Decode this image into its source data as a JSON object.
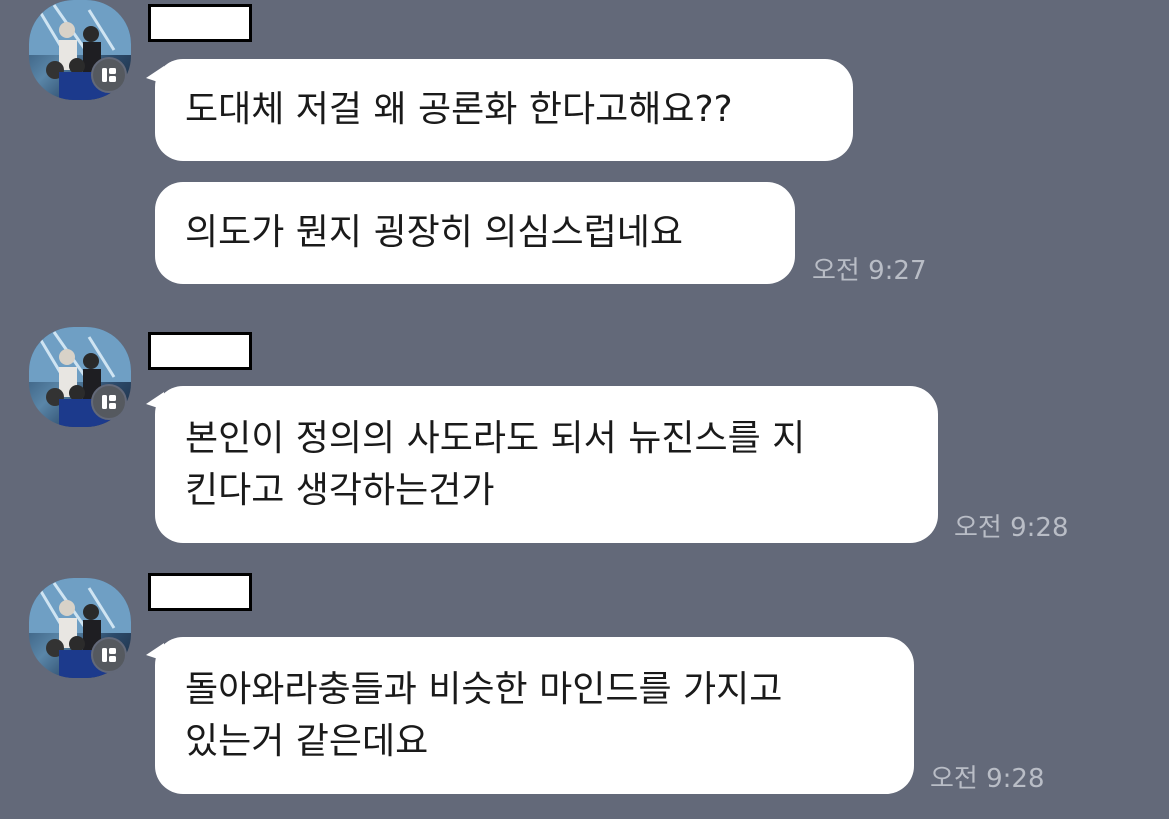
{
  "messages": [
    {
      "bubbles": [
        {
          "lines": [
            "도대체 저걸 왜 공론화 한다고해요??"
          ]
        },
        {
          "lines": [
            "의도가 뭔지 굉장히 의심스럽네요"
          ]
        }
      ],
      "time": "오전 9:27"
    },
    {
      "bubbles": [
        {
          "lines": [
            "본인이 정의의 사도라도 되서 뉴진스를 지",
            "킨다고 생각하는건가"
          ]
        }
      ],
      "time": "오전 9:28"
    },
    {
      "bubbles": [
        {
          "lines": [
            "돌아와라충들과 비슷한 마인드를 가지고",
            "있는거 같은데요"
          ]
        }
      ],
      "time": "오전 9:28"
    }
  ]
}
